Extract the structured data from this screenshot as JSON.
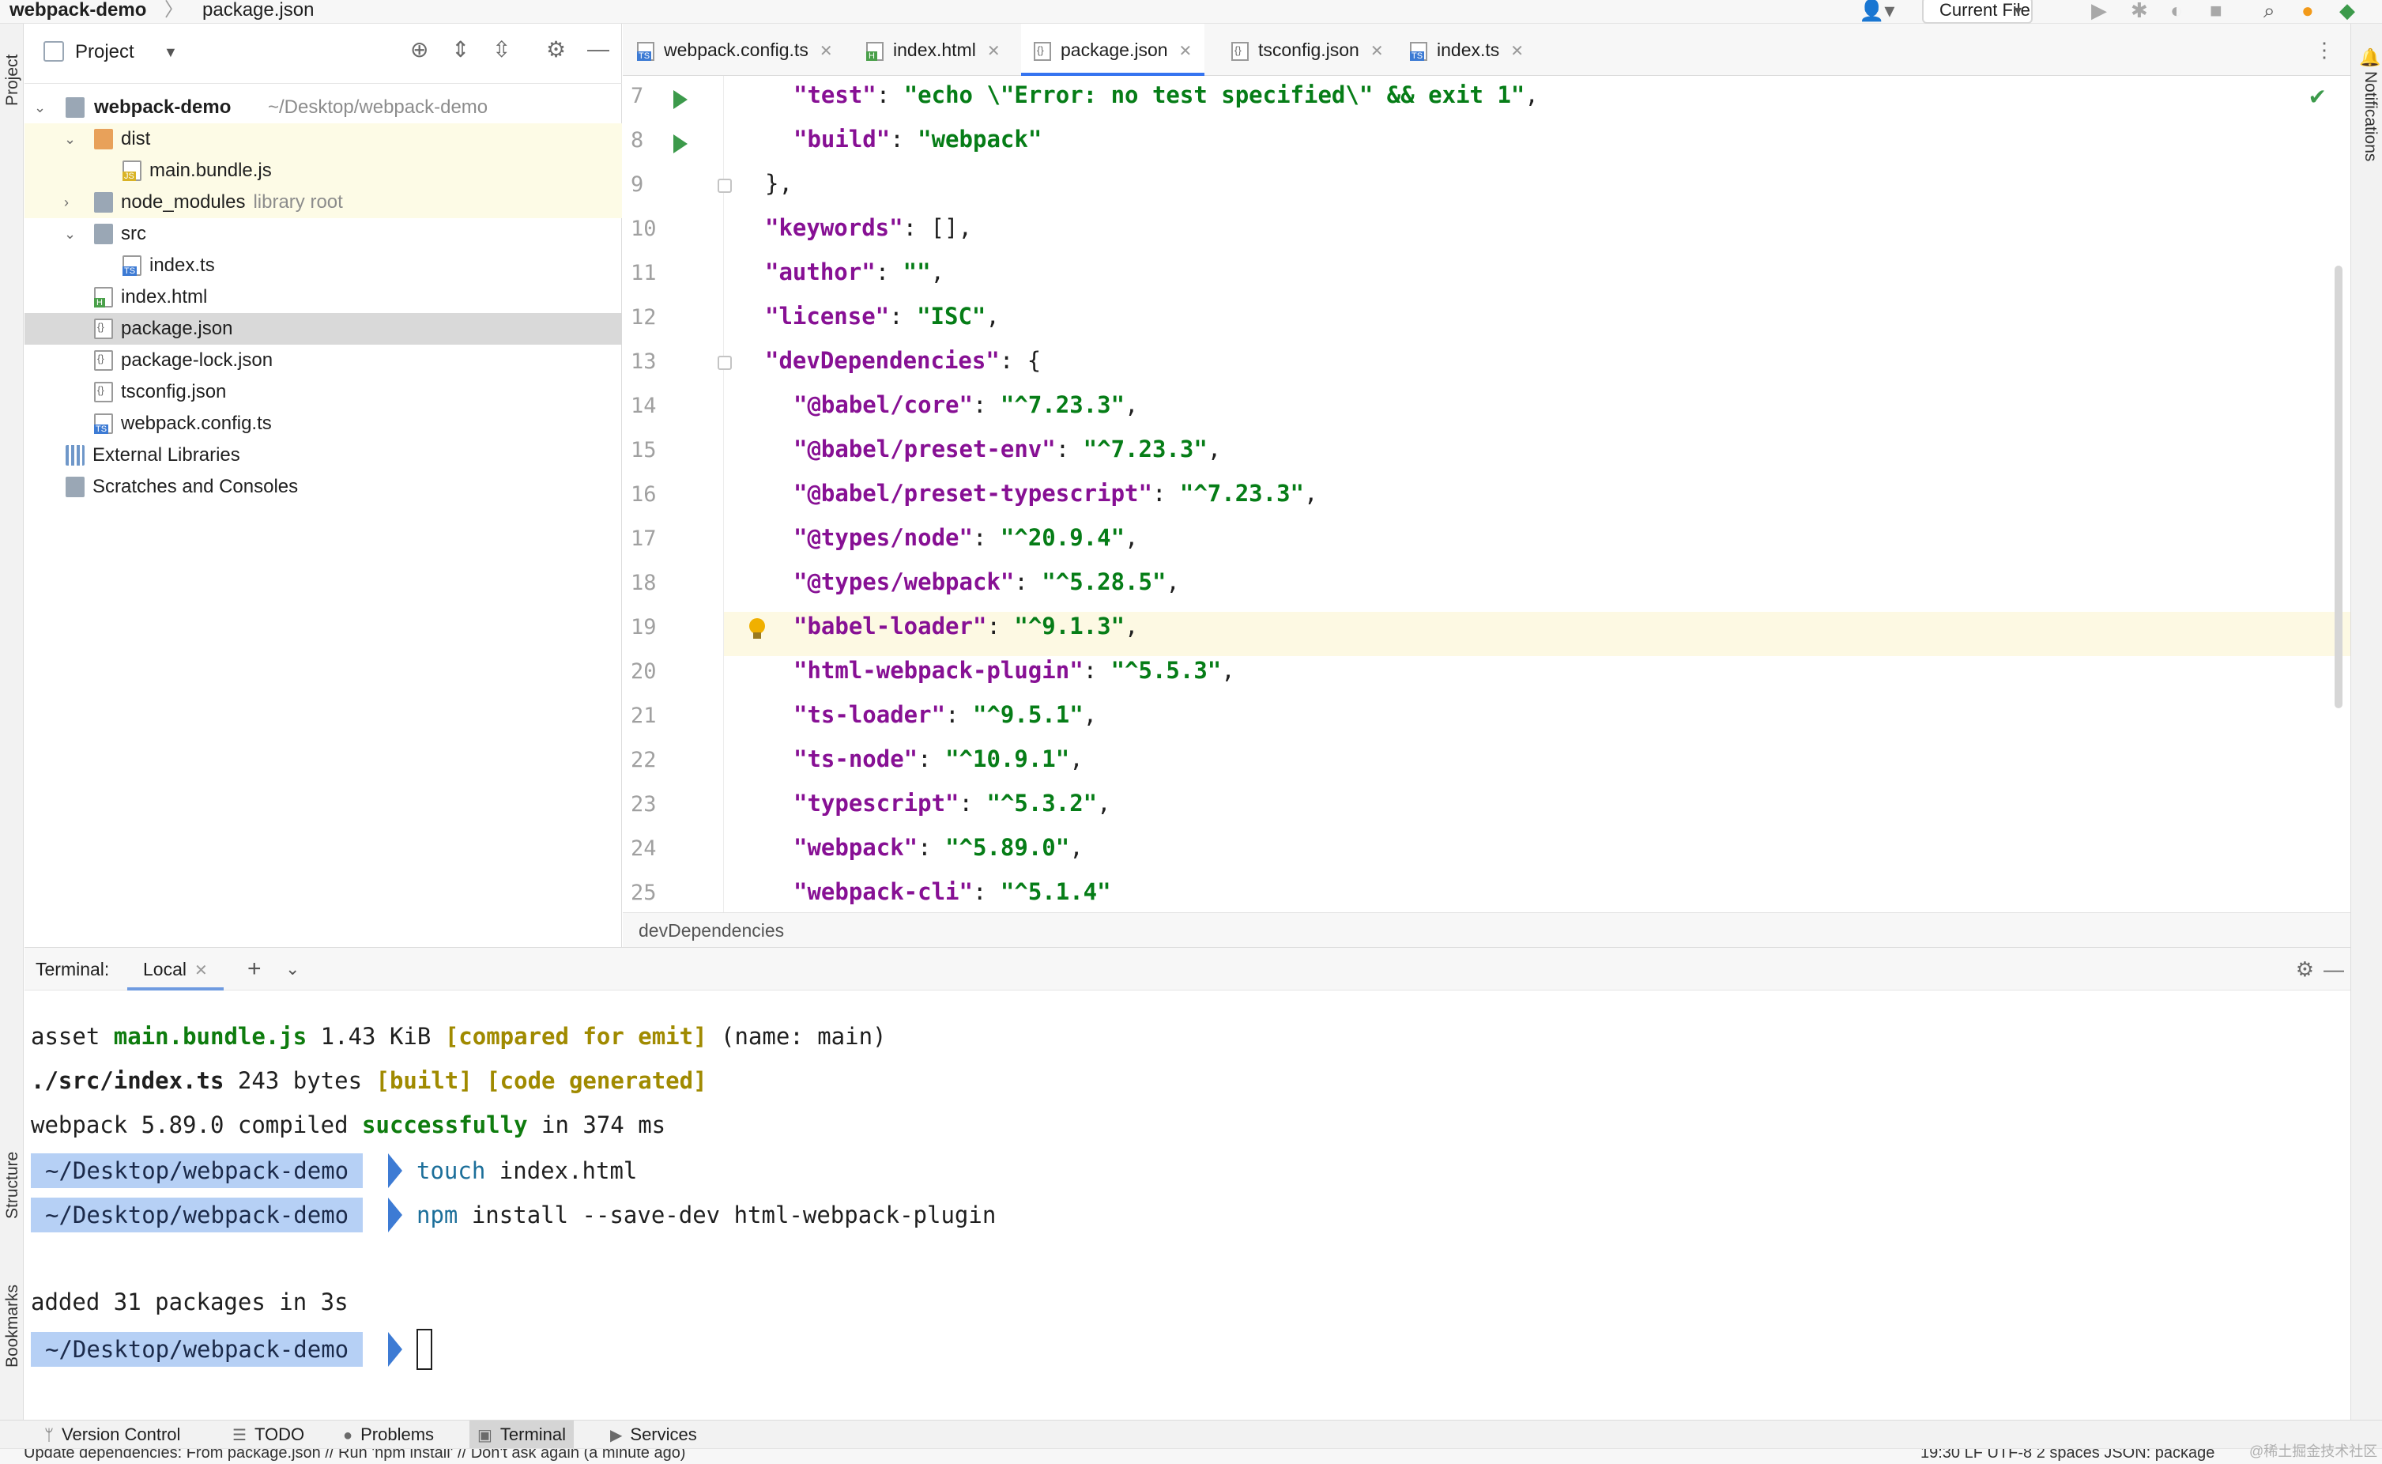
{
  "breadcrumb": {
    "project": "webpack-demo",
    "separator": "〉",
    "file": "package.json"
  },
  "toolbar": {
    "run_config": "Current File",
    "run_caret": "▾"
  },
  "tool_windows": {
    "left_top": "Project",
    "left_structure": "Structure",
    "left_bookmarks": "Bookmarks",
    "right": "Notifications"
  },
  "project": {
    "title": "Project",
    "root": {
      "name": "webpack-demo",
      "path": "~/Desktop/webpack-demo"
    },
    "items": [
      {
        "label": "dist"
      },
      {
        "label": "main.bundle.js"
      },
      {
        "label": "node_modules",
        "hint": "library root"
      },
      {
        "label": "src"
      },
      {
        "label": "index.ts"
      },
      {
        "label": "index.html"
      },
      {
        "label": "package.json"
      },
      {
        "label": "package-lock.json"
      },
      {
        "label": "tsconfig.json"
      },
      {
        "label": "webpack.config.ts"
      },
      {
        "label": "External Libraries"
      },
      {
        "label": "Scratches and Consoles"
      }
    ]
  },
  "tabs": [
    {
      "label": "webpack.config.ts"
    },
    {
      "label": "index.html"
    },
    {
      "label": "package.json"
    },
    {
      "label": "tsconfig.json"
    },
    {
      "label": "index.ts"
    }
  ],
  "editor": {
    "line_numbers": [
      "7",
      "8",
      "9",
      "10",
      "11",
      "12",
      "13",
      "14",
      "15",
      "16",
      "17",
      "18",
      "19",
      "20",
      "21",
      "22",
      "23",
      "24",
      "25"
    ],
    "lines": [
      {
        "key": "\"test\"",
        "punct": ": ",
        "value": "\"echo \\\"Error: no test specified\\\" && exit 1\"",
        "tail": ","
      },
      {
        "key": "\"build\"",
        "punct": ": ",
        "value": "\"webpack\"",
        "tail": ""
      },
      {
        "key": "",
        "punct": "},",
        "value": "",
        "tail": ""
      },
      {
        "key": "\"keywords\"",
        "punct": ": ",
        "value": "",
        "tail": "[],"
      },
      {
        "key": "\"author\"",
        "punct": ": ",
        "value": "\"\"",
        "tail": ","
      },
      {
        "key": "\"license\"",
        "punct": ": ",
        "value": "\"ISC\"",
        "tail": ","
      },
      {
        "key": "\"devDependencies\"",
        "punct": ": ",
        "value": "",
        "tail": "{"
      },
      {
        "key": "\"@babel/core\"",
        "punct": ": ",
        "value": "\"^7.23.3\"",
        "tail": ","
      },
      {
        "key": "\"@babel/preset-env\"",
        "punct": ": ",
        "value": "\"^7.23.3\"",
        "tail": ","
      },
      {
        "key": "\"@babel/preset-typescript\"",
        "punct": ": ",
        "value": "\"^7.23.3\"",
        "tail": ","
      },
      {
        "key": "\"@types/node\"",
        "punct": ": ",
        "value": "\"^20.9.4\"",
        "tail": ","
      },
      {
        "key": "\"@types/webpack\"",
        "punct": ": ",
        "value": "\"^5.28.5\"",
        "tail": ","
      },
      {
        "key": "\"babel-loader\"",
        "punct": ": ",
        "value": "\"^9.1.3\"",
        "tail": ","
      },
      {
        "key": "\"html-webpack-plugin\"",
        "punct": ": ",
        "value": "\"^5.5.3\"",
        "tail": ","
      },
      {
        "key": "\"ts-loader\"",
        "punct": ": ",
        "value": "\"^9.5.1\"",
        "tail": ","
      },
      {
        "key": "\"ts-node\"",
        "punct": ": ",
        "value": "\"^10.9.1\"",
        "tail": ","
      },
      {
        "key": "\"typescript\"",
        "punct": ": ",
        "value": "\"^5.3.2\"",
        "tail": ","
      },
      {
        "key": "\"webpack\"",
        "punct": ": ",
        "value": "\"^5.89.0\"",
        "tail": ","
      },
      {
        "key": "\"webpack-cli\"",
        "punct": ": ",
        "value": "\"^5.1.4\"",
        "tail": ""
      }
    ],
    "breadcrumb": "devDependencies"
  },
  "terminal": {
    "title": "Terminal:",
    "tab": "Local",
    "add": "+",
    "dropdown": "⌄",
    "out1": {
      "a": "asset ",
      "b": "main.bundle.js",
      "c": " 1.43 KiB ",
      "d": "[compared for emit]",
      "e": " (name: main)"
    },
    "out2": {
      "a": "./src/index.ts",
      "b": " 243 bytes ",
      "c": "[built]",
      "d": " ",
      "e": "[code generated]"
    },
    "out3": {
      "a": "webpack 5.89.0 compiled ",
      "b": "successfully",
      "c": " in 374 ms"
    },
    "prompt": "~/Desktop/webpack-demo",
    "cmd1": {
      "verb": "touch",
      "args": " index.html"
    },
    "cmd2": {
      "verb": "npm",
      "args": " install --save-dev html-webpack-plugin"
    },
    "out4": "added 31 packages in 3s"
  },
  "bottom_tools": {
    "version_control": "Version Control",
    "todo": "TODO",
    "problems": "Problems",
    "terminal": "Terminal",
    "services": "Services"
  },
  "status": {
    "message": "Update dependencies: From package.json // Run 'npm install' // Don't ask again (a minute ago)",
    "right": "19:30   LF   UTF-8   2 spaces   JSON: package"
  },
  "watermark": "@稀土掘金技术社区",
  "colors": {
    "accent": "#3574f0",
    "string": "#067d17",
    "key": "#871094",
    "prompt_bg": "#b6d0f5"
  }
}
